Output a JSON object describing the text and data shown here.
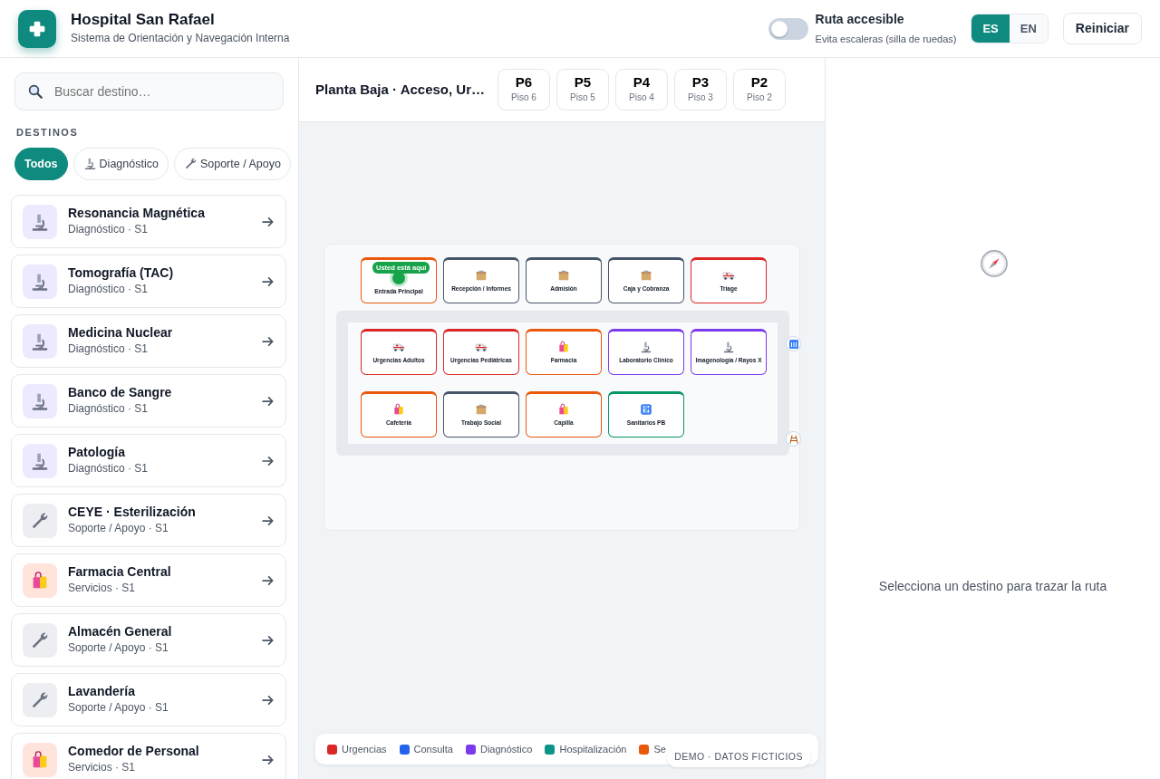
{
  "header": {
    "title": "Hospital San Rafael",
    "subtitle": "Sistema de Orientación y Navegación Interna",
    "accessible_route": {
      "label": "Ruta accesible",
      "hint": "Evita escaleras (silla de ruedas)",
      "on": false
    },
    "languages": [
      {
        "label": "ES",
        "selected": true
      },
      {
        "label": "EN",
        "selected": false
      }
    ],
    "reset_button": "Reiniciar"
  },
  "sidebar": {
    "search": {
      "placeholder": "Buscar destino…"
    },
    "section_title": "DESTINOS",
    "filters": [
      {
        "label": "Todos",
        "selected": true
      },
      {
        "label": "Diagnóstico",
        "kind": "microscope",
        "selected": false
      },
      {
        "label": "Soporte / Apoyo",
        "kind": "wrench",
        "selected": false
      }
    ],
    "destinations": [
      {
        "name": "Resonancia Magnética",
        "detail": "Diagnóstico · S1",
        "kind": "microscope"
      },
      {
        "name": "Tomografía (TAC)",
        "detail": "Diagnóstico · S1",
        "kind": "microscope"
      },
      {
        "name": "Medicina Nuclear",
        "detail": "Diagnóstico · S1",
        "kind": "microscope"
      },
      {
        "name": "Banco de Sangre",
        "detail": "Diagnóstico · S1",
        "kind": "microscope"
      },
      {
        "name": "Patología",
        "detail": "Diagnóstico · S1",
        "kind": "microscope"
      },
      {
        "name": "CEYE · Esterilización",
        "detail": "Soporte / Apoyo · S1",
        "kind": "wrench"
      },
      {
        "name": "Farmacia Central",
        "detail": "Servicios · S1",
        "kind": "bag"
      },
      {
        "name": "Almacén General",
        "detail": "Soporte / Apoyo · S1",
        "kind": "wrench"
      },
      {
        "name": "Lavandería",
        "detail": "Soporte / Apoyo · S1",
        "kind": "wrench"
      },
      {
        "name": "Comedor de Personal",
        "detail": "Servicios · S1",
        "kind": "bag"
      }
    ]
  },
  "map": {
    "floor_title": "Planta Baja · Acceso, Ur…",
    "floors": [
      {
        "code": "P6",
        "label": "Piso 6",
        "selected": false
      },
      {
        "code": "P5",
        "label": "Piso 5",
        "selected": false
      },
      {
        "code": "P4",
        "label": "Piso 4",
        "selected": false
      },
      {
        "code": "P3",
        "label": "Piso 3",
        "selected": false
      },
      {
        "code": "P2",
        "label": "Piso 2",
        "selected": false
      }
    ],
    "entrance_row": [
      {
        "name": "Entrada Principal",
        "color": "#ea580c",
        "you_are_here": true,
        "marker": "Usted está aquí"
      },
      {
        "name": "Recepción / Informes",
        "color": "#475569",
        "kind": "box"
      },
      {
        "name": "Admisión",
        "color": "#475569",
        "kind": "box"
      },
      {
        "name": "Caja y Cobranza",
        "color": "#475569",
        "kind": "box"
      },
      {
        "name": "Triage",
        "color": "#dc2626",
        "kind": "ambulance"
      }
    ],
    "corridor_rooms": [
      {
        "name": "Urgencias Adultos",
        "color": "#dc2626",
        "kind": "ambulance"
      },
      {
        "name": "Urgencias Pediátricas",
        "color": "#dc2626",
        "kind": "ambulance"
      },
      {
        "name": "Farmacia",
        "color": "#ea580c",
        "kind": "bag"
      },
      {
        "name": "Laboratorio Clínico",
        "color": "#7c3aed",
        "kind": "microscope"
      },
      {
        "name": "Imagenología / Rayos X",
        "color": "#7c3aed",
        "kind": "microscope"
      },
      {
        "name": "Cafetería",
        "color": "#ea580c",
        "kind": "bag"
      },
      {
        "name": "Trabajo Social",
        "color": "#475569",
        "kind": "box"
      },
      {
        "name": "Capilla",
        "color": "#ea580c",
        "kind": "bag"
      },
      {
        "name": "Sanitarios PB",
        "color": "#059669",
        "kind": "restroom"
      }
    ],
    "legend": [
      {
        "label": "Urgencias",
        "color": "#dc2626"
      },
      {
        "label": "Consulta",
        "color": "#2563eb"
      },
      {
        "label": "Diagnóstico",
        "color": "#7c3aed"
      },
      {
        "label": "Hospitalización",
        "color": "#0d9488"
      },
      {
        "label": "Se",
        "color": "#ea580c"
      }
    ],
    "demo_badge": "DEMO · DATOS FICTICIOS"
  },
  "route_panel": {
    "empty_message": "Selecciona un destino para trazar la ruta"
  }
}
